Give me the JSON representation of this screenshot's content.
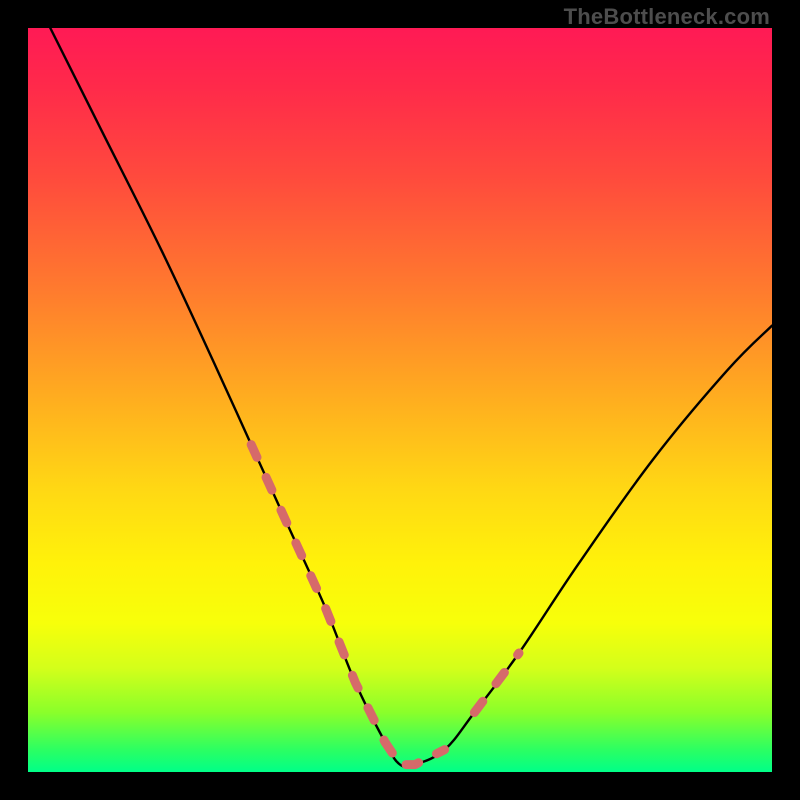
{
  "watermark": "TheBottleneck.com",
  "colors": {
    "background": "#000000",
    "curve": "#000000",
    "dash": "#d66a6a",
    "gradient_top": "#ff1a55",
    "gradient_bottom": "#00ff88"
  },
  "chart_data": {
    "type": "line",
    "title": "",
    "xlabel": "",
    "ylabel": "",
    "xlim": [
      0,
      100
    ],
    "ylim": [
      0,
      100
    ],
    "grid": false,
    "legend": false,
    "note": "Axes have no tick labels; x and y are normalized 0–100 reading from pixel positions. y=0 at bottom (green), y=100 at top (red). Curve is a V/check shape with minimum near x≈50.",
    "series": [
      {
        "name": "bottleneck-curve",
        "style": "solid",
        "x": [
          3,
          10,
          18,
          25,
          30,
          35,
          40,
          44,
          48,
          50,
          52,
          56,
          60,
          66,
          74,
          84,
          94,
          100
        ],
        "y": [
          100,
          86,
          70,
          55,
          44,
          33,
          22,
          12,
          4,
          1,
          1,
          3,
          8,
          16,
          28,
          42,
          54,
          60
        ]
      },
      {
        "name": "highlight-dashes-left",
        "style": "dashed",
        "x": [
          30,
          35,
          40,
          44,
          48
        ],
        "y": [
          44,
          33,
          22,
          12,
          4
        ]
      },
      {
        "name": "highlight-dashes-bottom",
        "style": "dashed",
        "x": [
          48,
          50,
          52,
          56
        ],
        "y": [
          4,
          1,
          1,
          3
        ]
      },
      {
        "name": "highlight-dashes-right",
        "style": "dashed",
        "x": [
          60,
          66
        ],
        "y": [
          8,
          16
        ]
      }
    ]
  }
}
